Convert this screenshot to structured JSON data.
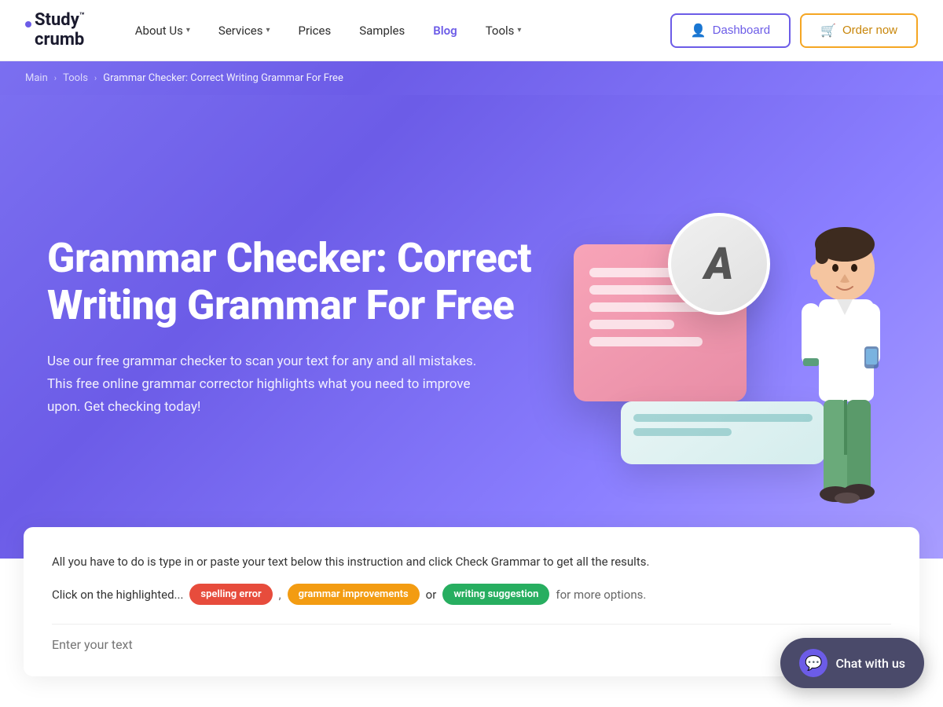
{
  "brand": {
    "name": "Study crumb",
    "name_line1": "Study",
    "name_line2": "crumb",
    "tm": "™"
  },
  "nav": {
    "about_label": "About Us",
    "services_label": "Services",
    "prices_label": "Prices",
    "samples_label": "Samples",
    "blog_label": "Blog",
    "tools_label": "Tools",
    "dashboard_label": "Dashboard",
    "order_label": "Order now"
  },
  "breadcrumb": {
    "main_label": "Main",
    "tools_label": "Tools",
    "current_label": "Grammar Checker: Correct Writing Grammar For Free"
  },
  "hero": {
    "title": "Grammar Checker: Correct Writing Grammar For Free",
    "description": "Use our free grammar checker to scan your text for any and all mistakes. This free online grammar corrector highlights what you need to improve upon. Get checking today!"
  },
  "tool": {
    "instruction": "All you have to do is type in or paste your text below this instruction and click Check Grammar to get all the results.",
    "highlight_prefix": "Click on the highlighted...",
    "spelling_badge": "spelling error",
    "grammar_badge": "grammar improvements",
    "writing_badge": "writing suggestion",
    "more_text": "for more options.",
    "input_placeholder": "Enter your text"
  },
  "chat": {
    "label": "Chat with us"
  }
}
